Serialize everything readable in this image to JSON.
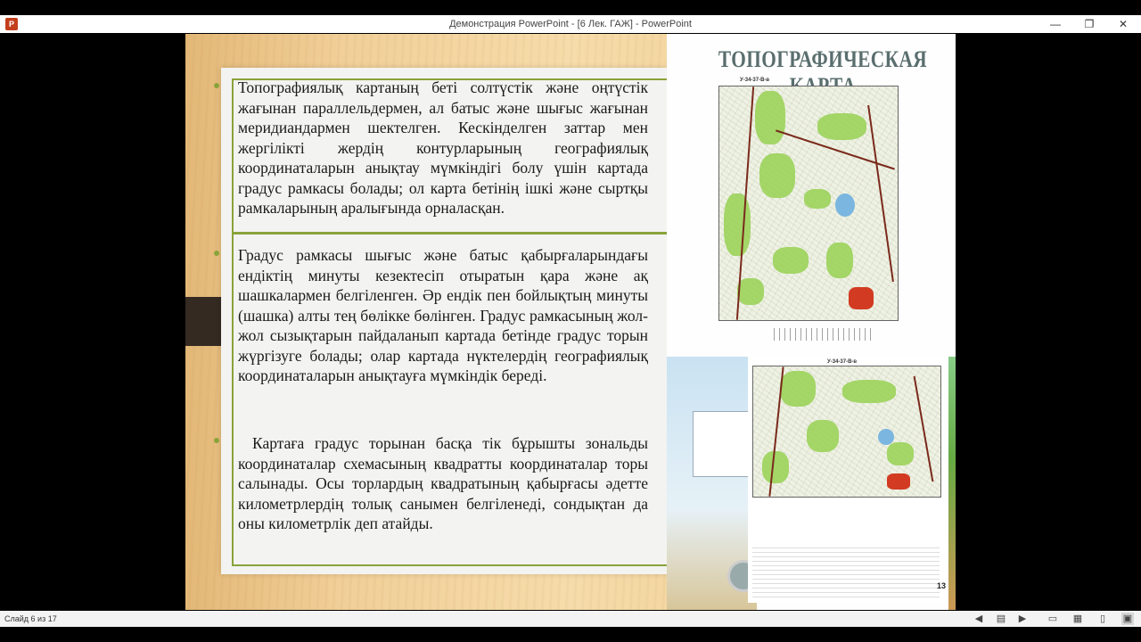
{
  "window": {
    "title": "Демонстрация PowerPoint - [6 Лек. ГАЖ] - PowerPoint",
    "app_icon": "P",
    "minimize": "—",
    "restore": "❐",
    "close": "✕"
  },
  "slide": {
    "paragraphs": [
      "Топографиялық картаның беті солтүстік және оңтүстік жағынан параллельдермен, ал батыс және шығыс жағынан меридиандармен шектелген. Кескінделген заттар мен жергілікті жердің контурларының географиялық координаталарын анықтау мүмкіндігі болу үшін картада градус рамкасы болады; ол карта бетінің ішкі және сыртқы рамкаларының аралығында орналасқан.",
      "Градус рамкасы шығыс және батыс қабырғаларындағы ендіктің минуты кезектесіп отыратын қара және ақ шашкалармен белгіленген. Әр ендік пен бойлықтың минуты (шашка) алты тең бөлікке бөлінген. Градус рамкасының жол-жол сызықтарын пайдаланып картада бетінде градус торын жүргізуге болады; олар картада нүктелердің географиялық координаталарын анықтауға мүмкіндік береді.",
      "Картаға градус торынан басқа тік бұрышты зональды координаталар схемасының квадратты координаталар торы салынады. Осы торлардың квадратының қабырғасы әдетте километрлердің толық санымен белгіленеді, сондықтан да оны километрлік деп атайды."
    ],
    "map_title": "ТОПОГРАФИЧЕСКАЯ КАРТА",
    "map_sheet_top": "У-34-37-В-в",
    "map_sheet_bottom": "У-34-37-В-в",
    "slide_number": "13",
    "accent_color": "#8aa33a"
  },
  "statusbar": {
    "slide_info": "Слайд 6 из 17",
    "icons": [
      "prev-icon",
      "slide-menu-icon",
      "next-icon",
      "normal-view-icon",
      "slide-sorter-icon",
      "reading-view-icon",
      "slideshow-icon"
    ]
  }
}
